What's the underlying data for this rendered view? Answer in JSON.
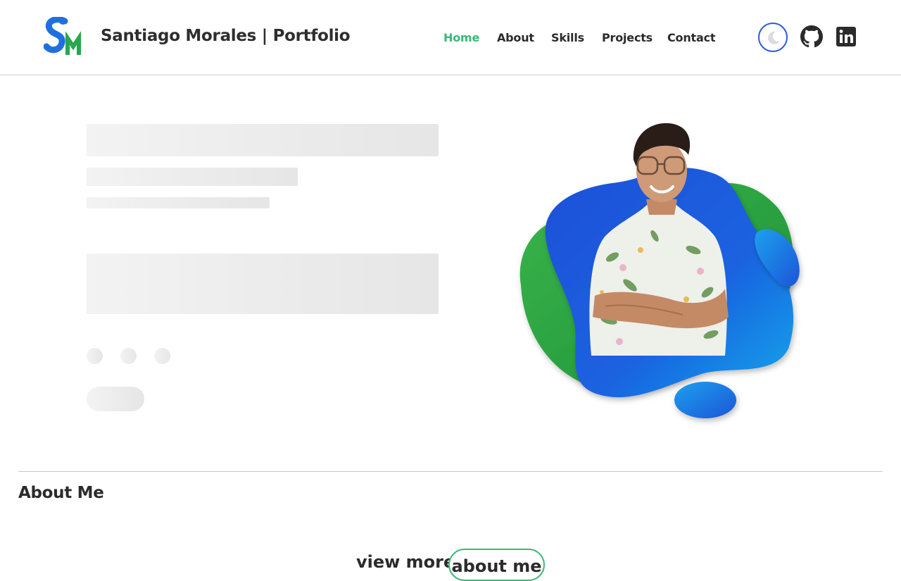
{
  "header": {
    "logo_text": "SM",
    "title": "Santiago Morales | Portfolio",
    "nav": [
      {
        "label": "Home",
        "active": true
      },
      {
        "label": "About",
        "active": false
      },
      {
        "label": "Skills",
        "active": false
      },
      {
        "label": "Projects",
        "active": false
      },
      {
        "label": "Contact",
        "active": false
      }
    ],
    "icons": {
      "theme_toggle": "moon-icon",
      "github": "github-icon",
      "linkedin": "linkedin-icon"
    }
  },
  "hero": {
    "loading": true,
    "image": "profile-photo-on-blue-green-blob"
  },
  "about": {
    "title": "About Me",
    "view_more_label": "view more",
    "button_label": "about me"
  },
  "colors": {
    "accent_green": "#3cb878",
    "accent_blue": "#2f5bd9",
    "text": "#2b2b2b",
    "skeleton": "#ececec"
  }
}
